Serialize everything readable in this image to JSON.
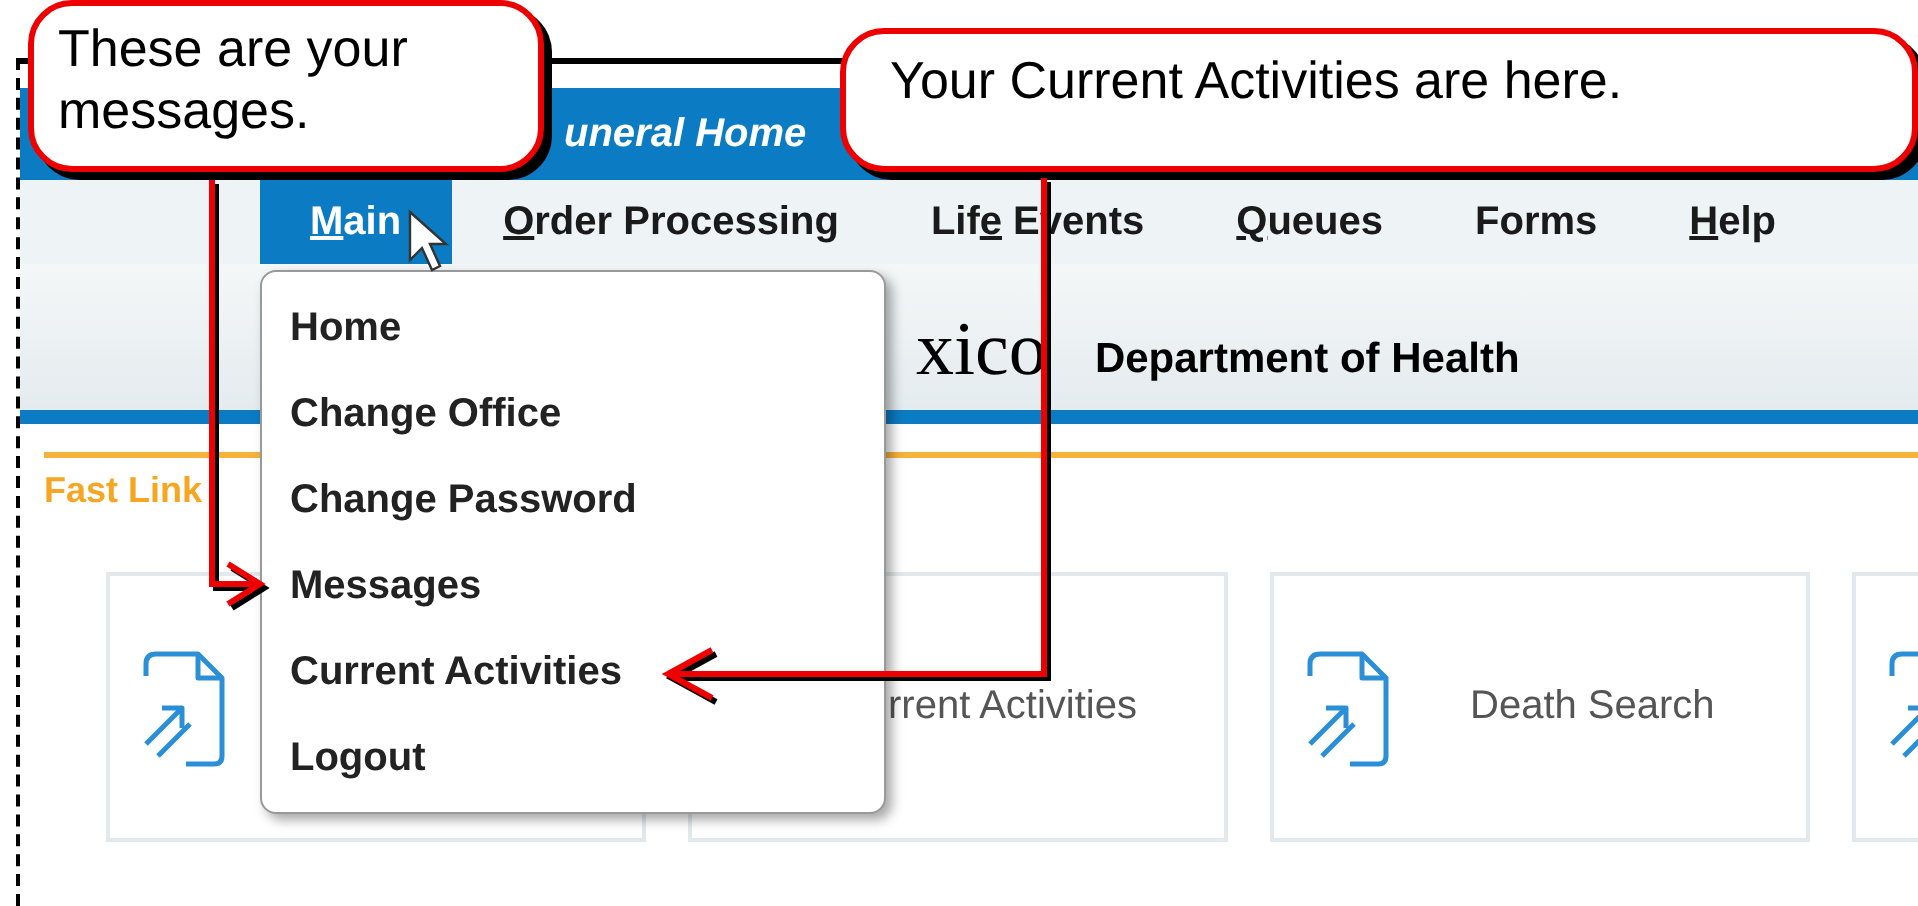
{
  "header": {
    "title": "uneral Home"
  },
  "menu_bar": [
    {
      "key": "M",
      "after": "ain",
      "selected": true
    },
    {
      "key": "O",
      "after": "rder Processing",
      "selected": false
    },
    {
      "before": "Lif",
      "key": "e",
      "after": " Events",
      "selected": false
    },
    {
      "key": "Q",
      "after": "ueues",
      "selected": false
    },
    {
      "before": "Forms",
      "selected": false
    },
    {
      "key": "H",
      "after": "elp",
      "selected": false
    }
  ],
  "banner": {
    "state_name": "xico",
    "department": "Department of Health"
  },
  "fast_links": {
    "title": "Fast Link",
    "tiles": [
      {
        "kind": "link"
      },
      {
        "kind": "text_only",
        "label": "rrent Activities"
      },
      {
        "kind": "link",
        "label": "Death Search"
      },
      {
        "kind": "link"
      }
    ]
  },
  "dropdown": {
    "items": [
      "Home",
      "Change Office",
      "Change Password",
      "Messages",
      "Current Activities",
      "Logout"
    ]
  },
  "callouts": [
    {
      "text": "These are your messages."
    },
    {
      "text": "Your Current Activities are here."
    }
  ]
}
